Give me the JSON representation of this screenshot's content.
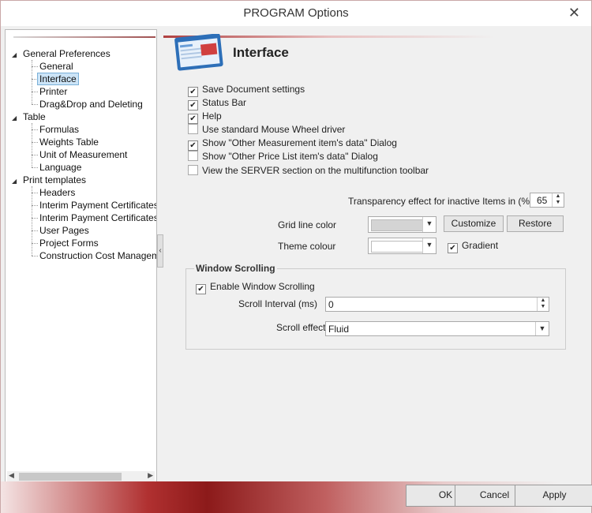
{
  "window": {
    "title": "PROGRAM Options"
  },
  "tree": {
    "groups": [
      {
        "label": "General Preferences",
        "children": [
          "General",
          "Interface",
          "Printer",
          "Drag&Drop and Deleting"
        ]
      },
      {
        "label": "Table",
        "children": [
          "Formulas",
          "Weights Table",
          "Unit of Measurement",
          "Language"
        ]
      },
      {
        "label": "Print templates",
        "children": [
          "Headers",
          "Interim Payment Certificates",
          "Interim Payment Certificates (E",
          "User Pages",
          "Project Forms",
          "Construction Cost Managemen"
        ]
      }
    ],
    "selected": "Interface"
  },
  "page": {
    "heading": "Interface"
  },
  "options": [
    {
      "label": "Save Document settings",
      "checked": true
    },
    {
      "label": "Status Bar",
      "checked": true
    },
    {
      "label": "Help",
      "checked": true
    },
    {
      "label": "Use standard Mouse Wheel driver",
      "checked": false
    },
    {
      "label": "Show \"Other Measurement item's data\" Dialog",
      "checked": true
    },
    {
      "label": "Show \"Other Price List item's data\" Dialog",
      "checked": false
    },
    {
      "label": "View the SERVER section on the multifunction toolbar",
      "checked": false
    }
  ],
  "transparency": {
    "label": "Transparency effect for inactive Items in (%)",
    "value": "65"
  },
  "gridline": {
    "label": "Grid line color",
    "color": "#d4d4d4",
    "customize": "Customize",
    "restore": "Restore"
  },
  "theme": {
    "label": "Theme colour",
    "color": "#ffffff",
    "gradient_label": "Gradient",
    "gradient_checked": true
  },
  "scrolling": {
    "title": "Window Scrolling",
    "enable_label": "Enable Window Scrolling",
    "enable_checked": true,
    "interval_label": "Scroll Interval (ms)",
    "interval_value": "0",
    "effect_label": "Scroll effect",
    "effect_value": "Fluid"
  },
  "footer": {
    "ok": "OK",
    "cancel": "Cancel",
    "apply": "Apply"
  },
  "colors": {
    "accent": "#9e2a2a",
    "selection": "#cce4f7"
  }
}
